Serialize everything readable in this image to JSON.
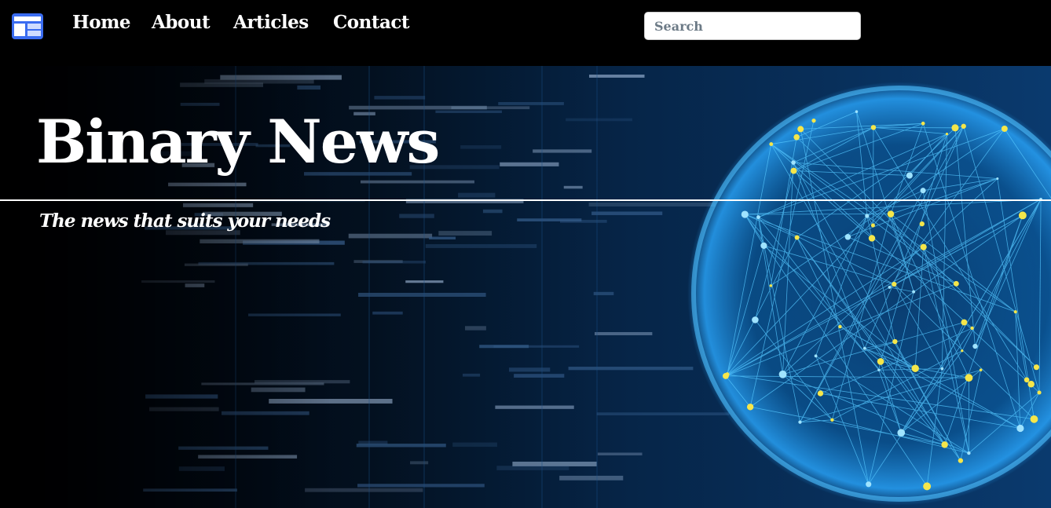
{
  "navbar": {
    "logo_icon": "layout-window-icon",
    "links": [
      {
        "label": "Home"
      },
      {
        "label": "About"
      },
      {
        "label": "Articles"
      },
      {
        "label": "Contact"
      }
    ],
    "search": {
      "placeholder": "Search",
      "value": ""
    }
  },
  "hero": {
    "title": "Binary News",
    "tagline": "The news that suits your needs",
    "background_image": "code-screen-and-digital-network-globe"
  },
  "colors": {
    "navbar_bg": "#000000",
    "text": "#ffffff",
    "accent_blue": "#2aa8ff",
    "node_yellow": "#f5e64a",
    "logo_blue": "#3a6cf0"
  }
}
